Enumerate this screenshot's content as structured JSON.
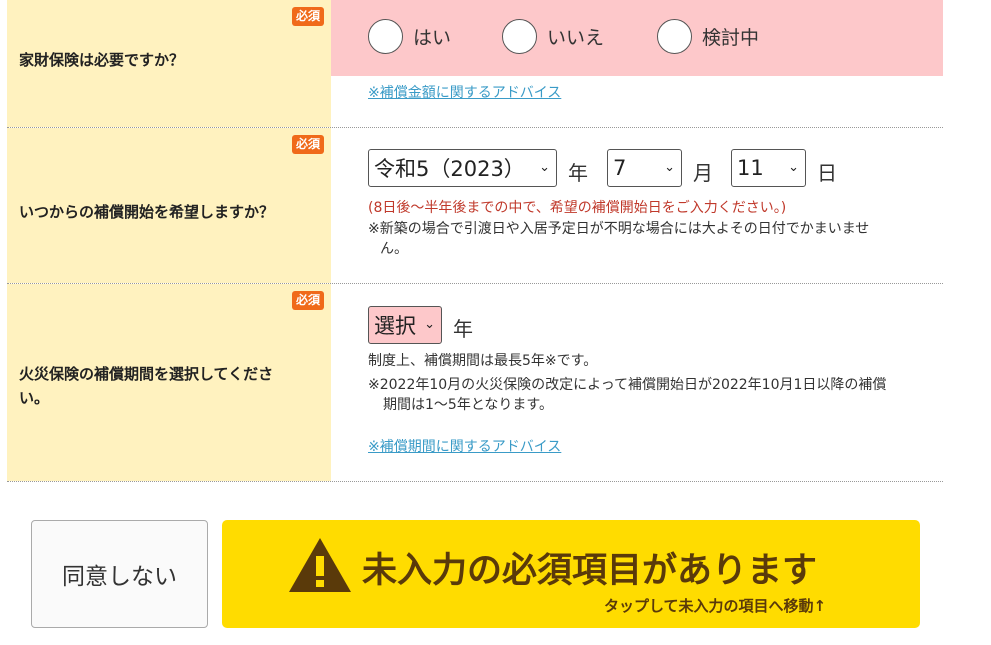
{
  "badges": {
    "required": "必須"
  },
  "q1": {
    "label": "家財保険は必要ですか？",
    "options": [
      "はい",
      "いいえ",
      "検討中"
    ],
    "advice_link": "※補償金額に関するアドバイス"
  },
  "q2": {
    "label": "いつからの補償開始を希望しますか？",
    "year_value": "令和5（2023）",
    "year_unit": "年",
    "month_value": "7",
    "month_unit": "月",
    "day_value": "11",
    "day_unit": "日",
    "hint_red": "(8日後～半年後までの中で、希望の補償開始日をご入力ください。)",
    "note_line1": "※新築の場合で引渡日や入居予定日が不明な場合には大よその日付でかまいませ",
    "note_line2": "ん。"
  },
  "q3": {
    "label_line1": "火災保険の補償期間を選択してくださ",
    "label_line2": "い。",
    "select_value": "選択",
    "unit": "年",
    "note1": "制度上、補償期間は最長5年※です。",
    "note2_line1": "※2022年10月の火災保険の改定によって補償開始日が2022年10月1日以降の補償",
    "note2_line2": "期間は1～5年となります。",
    "advice_link": "※補償期間に関するアドバイス"
  },
  "buttons": {
    "disagree": "同意しない",
    "submit_main": "未入力の必須項目があります",
    "submit_sub": "タップして未入力の項目へ移動↑"
  },
  "colors": {
    "label_bg": "#fff2bf",
    "radio_band": "#fdc8ca",
    "badge": "#f06a1a",
    "submit_bg": "#ffdc00",
    "link": "#3a9bc7"
  }
}
